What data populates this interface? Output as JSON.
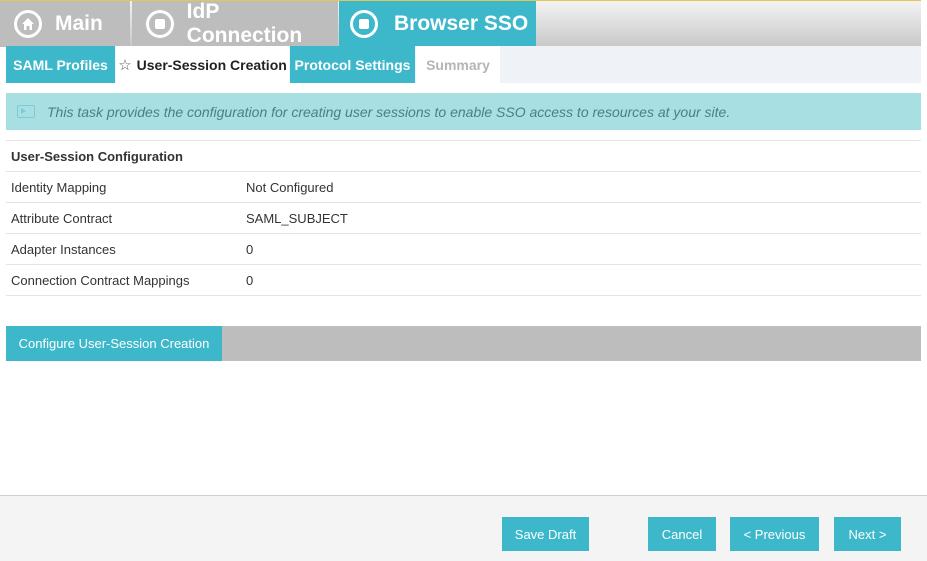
{
  "top_tabs": {
    "main": "Main",
    "idp": "IdP Connection",
    "sso": "Browser SSO"
  },
  "sub_tabs": {
    "saml": "SAML Profiles",
    "user_session": "User-Session Creation",
    "protocol": "Protocol Settings",
    "summary": "Summary"
  },
  "info": {
    "text": "This task provides the configuration for creating user sessions to enable SSO access to resources at your site."
  },
  "config": {
    "heading": "User-Session Configuration",
    "rows": [
      {
        "label": "Identity Mapping",
        "value": "Not Configured"
      },
      {
        "label": "Attribute Contract",
        "value": "SAML_SUBJECT"
      },
      {
        "label": "Adapter Instances",
        "value": "0"
      },
      {
        "label": "Connection Contract Mappings",
        "value": "0"
      }
    ]
  },
  "configure_button": "Configure User-Session Creation",
  "footer": {
    "save_draft": "Save Draft",
    "cancel": "Cancel",
    "previous": "< Previous",
    "next": "Next >"
  },
  "colors": {
    "accent": "#3db8cb",
    "banner": "#a7dfe2",
    "inactive_tab": "#bdbdbd"
  }
}
